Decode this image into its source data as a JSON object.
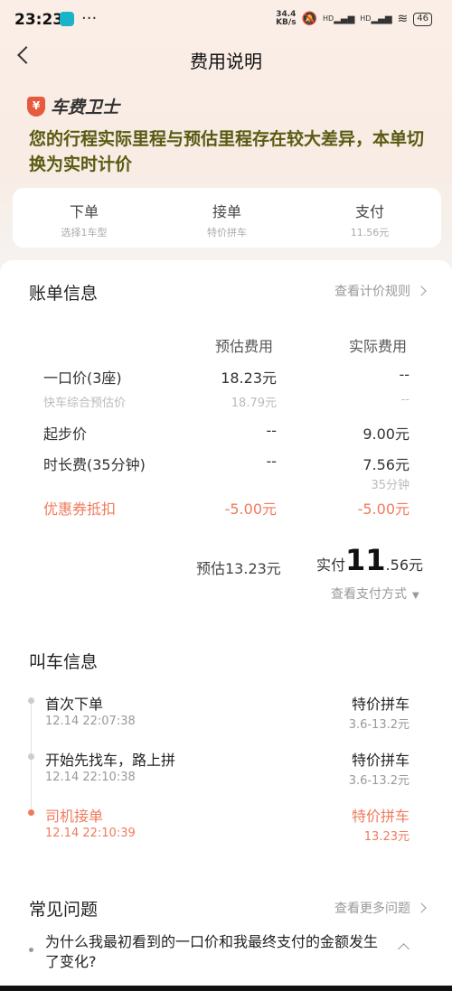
{
  "status": {
    "time": "23:23",
    "speed_top": "34.4",
    "speed_bottom": "KB/s",
    "hd1": "HD",
    "hd2": "HD",
    "battery": "46"
  },
  "nav": {
    "title": "费用说明"
  },
  "guard": {
    "name": "车费卫士",
    "notice": "您的行程实际里程与预估里程存在较大差异，本单切换为实时计价"
  },
  "steps": [
    {
      "title": "下单",
      "sub": "选择1车型"
    },
    {
      "title": "接单",
      "sub": "特价拼车"
    },
    {
      "title": "支付",
      "sub": "11.56元"
    }
  ],
  "bill": {
    "title": "账单信息",
    "rule_link": "查看计价规则",
    "col_est": "预估费用",
    "col_act": "实际费用",
    "rows": [
      {
        "label": "一口价(3座)",
        "est": "18.23元",
        "act": "--"
      },
      {
        "label": "快车综合预估价",
        "est": "18.79元",
        "act": "--"
      },
      {
        "label": "起步价",
        "est": "--",
        "act": "9.00元"
      },
      {
        "label": "时长费(35分钟)",
        "est": "--",
        "act": "7.56元",
        "act_sub": "35分钟"
      },
      {
        "label": "优惠券抵扣",
        "est": "-5.00元",
        "act": "-5.00元"
      }
    ],
    "est_total": "预估13.23元",
    "paid_prefix": "实付",
    "paid_int": "11",
    "paid_dec": ".56元",
    "pay_method": "查看支付方式"
  },
  "call": {
    "title": "叫车信息",
    "events": [
      {
        "title": "首次下单",
        "time": "12.14 22:07:38",
        "type": "特价拼车",
        "price": "3.6-13.2元"
      },
      {
        "title": "开始先找车，路上拼",
        "time": "12.14 22:10:38",
        "type": "特价拼车",
        "price": "3.6-13.2元"
      },
      {
        "title": "司机接单",
        "time": "12.14 22:10:39",
        "type": "特价拼车",
        "price": "13.23元"
      }
    ]
  },
  "faq": {
    "title": "常见问题",
    "more_link": "查看更多问题",
    "q1": "为什么我最初看到的一口价和我最终支付的金额发生了变化?"
  },
  "colors": {
    "accent": "#f07a5d",
    "notice": "#5a5a12"
  }
}
